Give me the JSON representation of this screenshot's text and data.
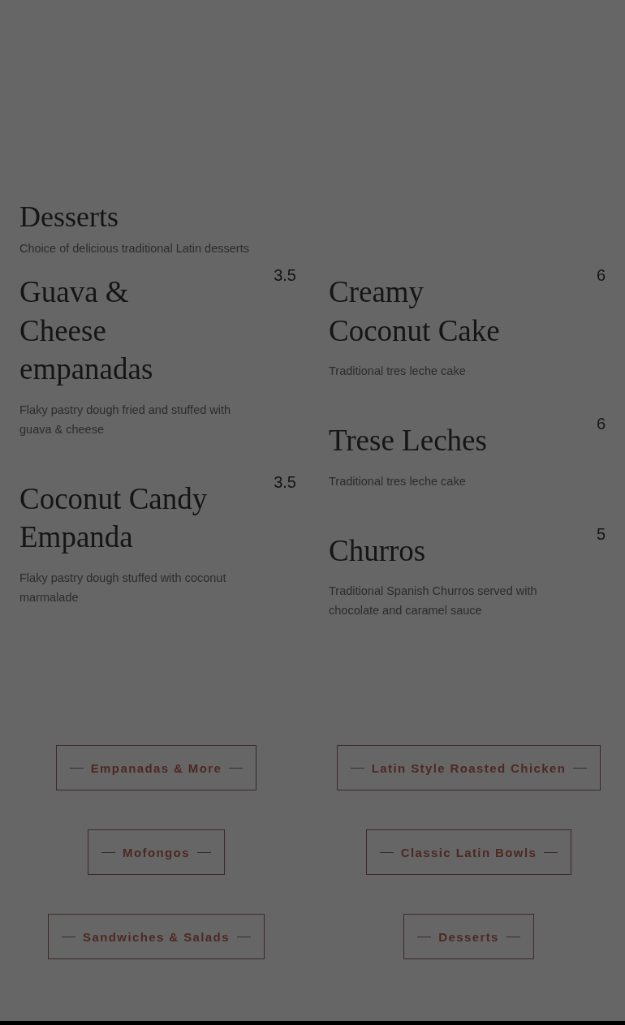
{
  "section": {
    "title": "Desserts",
    "subtitle": "Choice of delicious traditional Latin desserts"
  },
  "columns": [
    [
      {
        "name": "Guava & Cheese empanadas",
        "price": "3.5",
        "description": "Flaky pastry dough fried and stuffed with guava & cheese"
      },
      {
        "name": "Coconut Candy Empanda",
        "price": "3.5",
        "description": "Flaky pastry dough stuffed with coconut marmalade"
      }
    ],
    [
      {
        "name": "Creamy Coconut Cake",
        "price": "6",
        "description": "Traditional tres leche cake"
      },
      {
        "name": "Trese Leches",
        "price": "6",
        "description": "Traditional tres leche cake"
      },
      {
        "name": "Churros",
        "price": "5",
        "description": "Traditional Spanish Churros served with chocolate and caramel sauce"
      }
    ]
  ],
  "category_links": [
    "Empanadas & More",
    "Latin Style Roasted Chicken",
    "Mofongos",
    "Classic Latin Bowls",
    "Sandwiches & Salads",
    "Desserts"
  ]
}
